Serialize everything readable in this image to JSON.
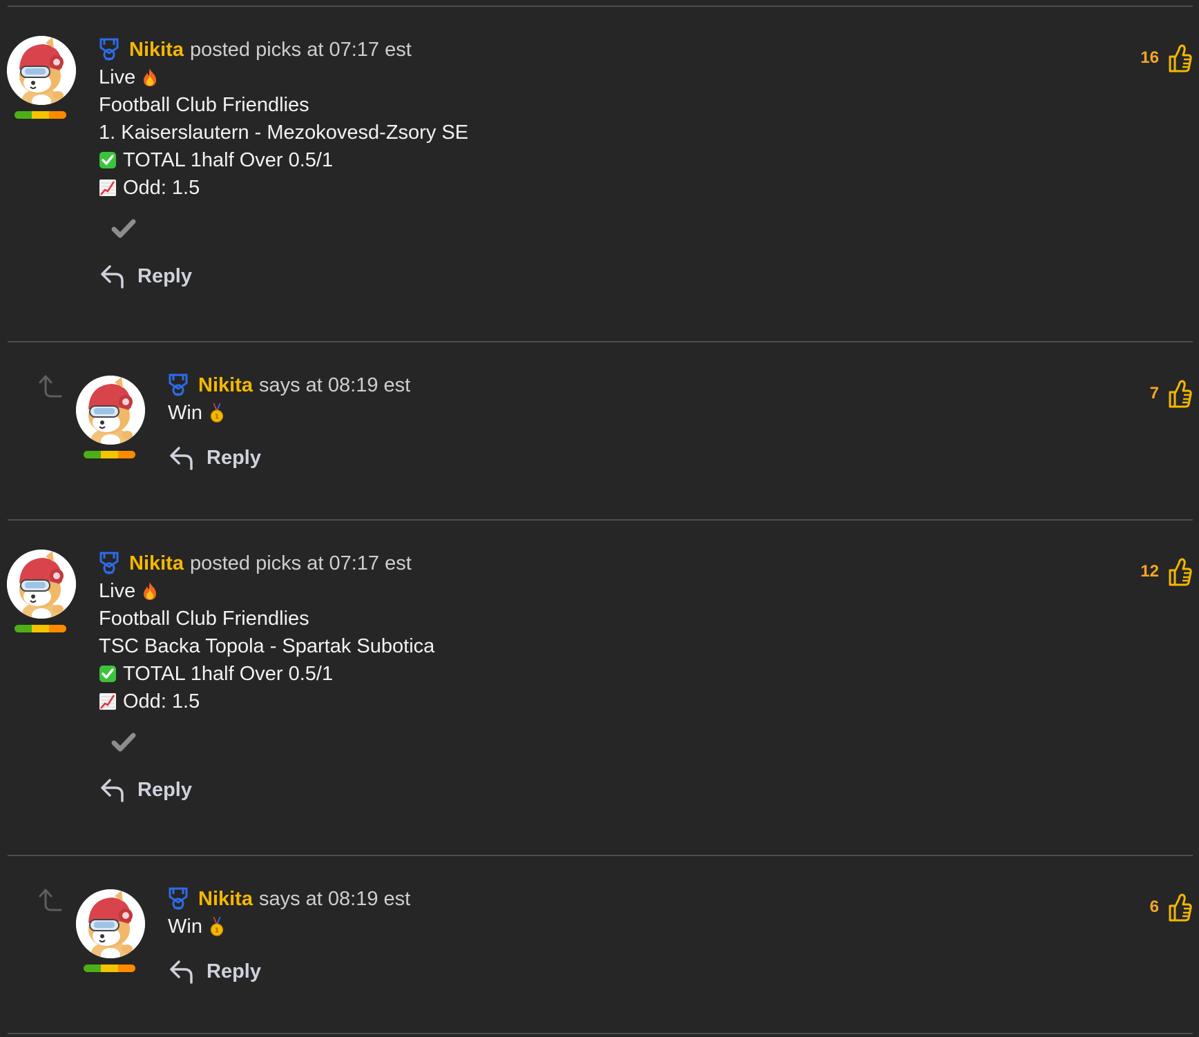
{
  "colors": {
    "background": "#262626",
    "author": "#f5b800",
    "likes": "#f5a623",
    "divider": "#4d4d4d",
    "level_bar": [
      "#4caf1a",
      "#f5c400",
      "#ff8a00"
    ]
  },
  "posts": [
    {
      "type": "pick",
      "author": "Nikita",
      "meta": "posted picks at 07:17 est",
      "lines": [
        {
          "text": "Live",
          "trailing_icon": "fire-emoji"
        },
        {
          "text": "Football Club Friendlies"
        },
        {
          "text": "1. Kaiserslautern - Mezokovesd-Zsory SE"
        },
        {
          "text": "TOTAL 1half Over 0.5/1",
          "leading_icon": "green-check-emoji"
        },
        {
          "text": "Odd: 1.5",
          "leading_icon": "chart-emoji"
        }
      ],
      "reply_label": "Reply",
      "likes": "16"
    },
    {
      "type": "reply",
      "author": "Nikita",
      "meta": "says at 08:19 est",
      "lines": [
        {
          "text": "Win",
          "trailing_icon": "medal-emoji"
        }
      ],
      "reply_label": "Reply",
      "likes": "7"
    },
    {
      "type": "pick",
      "author": "Nikita",
      "meta": "posted picks at 07:17 est",
      "lines": [
        {
          "text": "Live",
          "trailing_icon": "fire-emoji"
        },
        {
          "text": "Football Club Friendlies"
        },
        {
          "text": "TSC Backa Topola - Spartak Subotica"
        },
        {
          "text": "TOTAL 1half Over 0.5/1",
          "leading_icon": "green-check-emoji"
        },
        {
          "text": "Odd: 1.5",
          "leading_icon": "chart-emoji"
        }
      ],
      "reply_label": "Reply",
      "likes": "12"
    },
    {
      "type": "reply",
      "author": "Nikita",
      "meta": "says at 08:19 est",
      "lines": [
        {
          "text": "Win",
          "trailing_icon": "medal-emoji"
        }
      ],
      "reply_label": "Reply",
      "likes": "6"
    }
  ]
}
